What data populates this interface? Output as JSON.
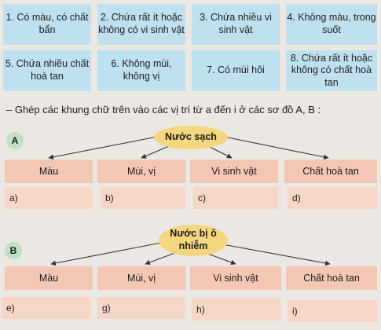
{
  "cards": [
    "1. Có màu, có chất bẩn",
    "2. Chứa rất ít hoặc không có vi sinh vật",
    "3. Chứa nhiều vi sinh vật",
    "4. Không màu, trong suốt",
    "5. Chứa nhiều chất hoà tan",
    "6. Không mùi, không vị",
    "7. Có mùi hôi",
    "8. Chứa rất ít hoặc không có chất hoà tan"
  ],
  "instruction": "– Ghép các khung chữ trên vào các vị trí từ a đến i ở các sơ đồ A, B :",
  "diagramA": {
    "badge": "A",
    "center": "Nước sạch",
    "categories": [
      "Màu",
      "Mùi, vị",
      "Vi sinh vật",
      "Chất hoà tan"
    ],
    "answers": [
      "a)",
      "b)",
      "c)",
      "d)"
    ]
  },
  "diagramB": {
    "badge": "B",
    "center": "Nước bị ô nhiễm",
    "categories": [
      "Màu",
      "Mùi, vị",
      "Vi sinh vật",
      "Chất hoà tan"
    ],
    "answers": [
      "e)",
      "g)",
      "h)",
      "i)"
    ]
  }
}
